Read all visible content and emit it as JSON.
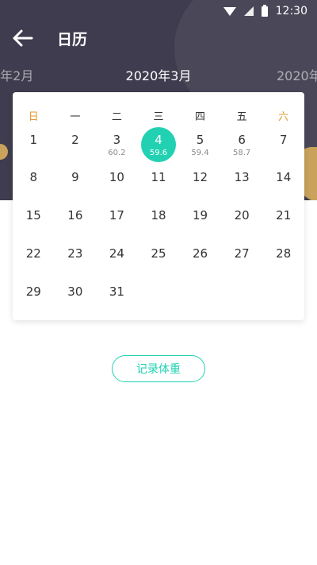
{
  "status_bar": {
    "time": "12:30"
  },
  "app_bar": {
    "title": "日历"
  },
  "months": {
    "prev": "0年2月",
    "current": "2020年3月",
    "next": "2020年"
  },
  "weekdays": [
    "日",
    "一",
    "二",
    "三",
    "四",
    "五",
    "六"
  ],
  "colors": {
    "accent": "#22d1b2",
    "weekend": "#e29a2c",
    "header_bg": "#3e3c4e"
  },
  "days": [
    {
      "d": "1",
      "w": ""
    },
    {
      "d": "2",
      "w": ""
    },
    {
      "d": "3",
      "w": "60.2"
    },
    {
      "d": "4",
      "w": "59.6",
      "selected": true
    },
    {
      "d": "5",
      "w": "59.4"
    },
    {
      "d": "6",
      "w": "58.7"
    },
    {
      "d": "7",
      "w": ""
    },
    {
      "d": "8",
      "w": ""
    },
    {
      "d": "9",
      "w": ""
    },
    {
      "d": "10",
      "w": ""
    },
    {
      "d": "11",
      "w": ""
    },
    {
      "d": "12",
      "w": ""
    },
    {
      "d": "13",
      "w": ""
    },
    {
      "d": "14",
      "w": ""
    },
    {
      "d": "15",
      "w": ""
    },
    {
      "d": "16",
      "w": ""
    },
    {
      "d": "17",
      "w": ""
    },
    {
      "d": "18",
      "w": ""
    },
    {
      "d": "19",
      "w": ""
    },
    {
      "d": "20",
      "w": ""
    },
    {
      "d": "21",
      "w": ""
    },
    {
      "d": "22",
      "w": ""
    },
    {
      "d": "23",
      "w": ""
    },
    {
      "d": "24",
      "w": ""
    },
    {
      "d": "25",
      "w": ""
    },
    {
      "d": "26",
      "w": ""
    },
    {
      "d": "27",
      "w": ""
    },
    {
      "d": "28",
      "w": ""
    },
    {
      "d": "29",
      "w": ""
    },
    {
      "d": "30",
      "w": ""
    },
    {
      "d": "31",
      "w": ""
    }
  ],
  "record_button": {
    "label": "记录体重"
  }
}
